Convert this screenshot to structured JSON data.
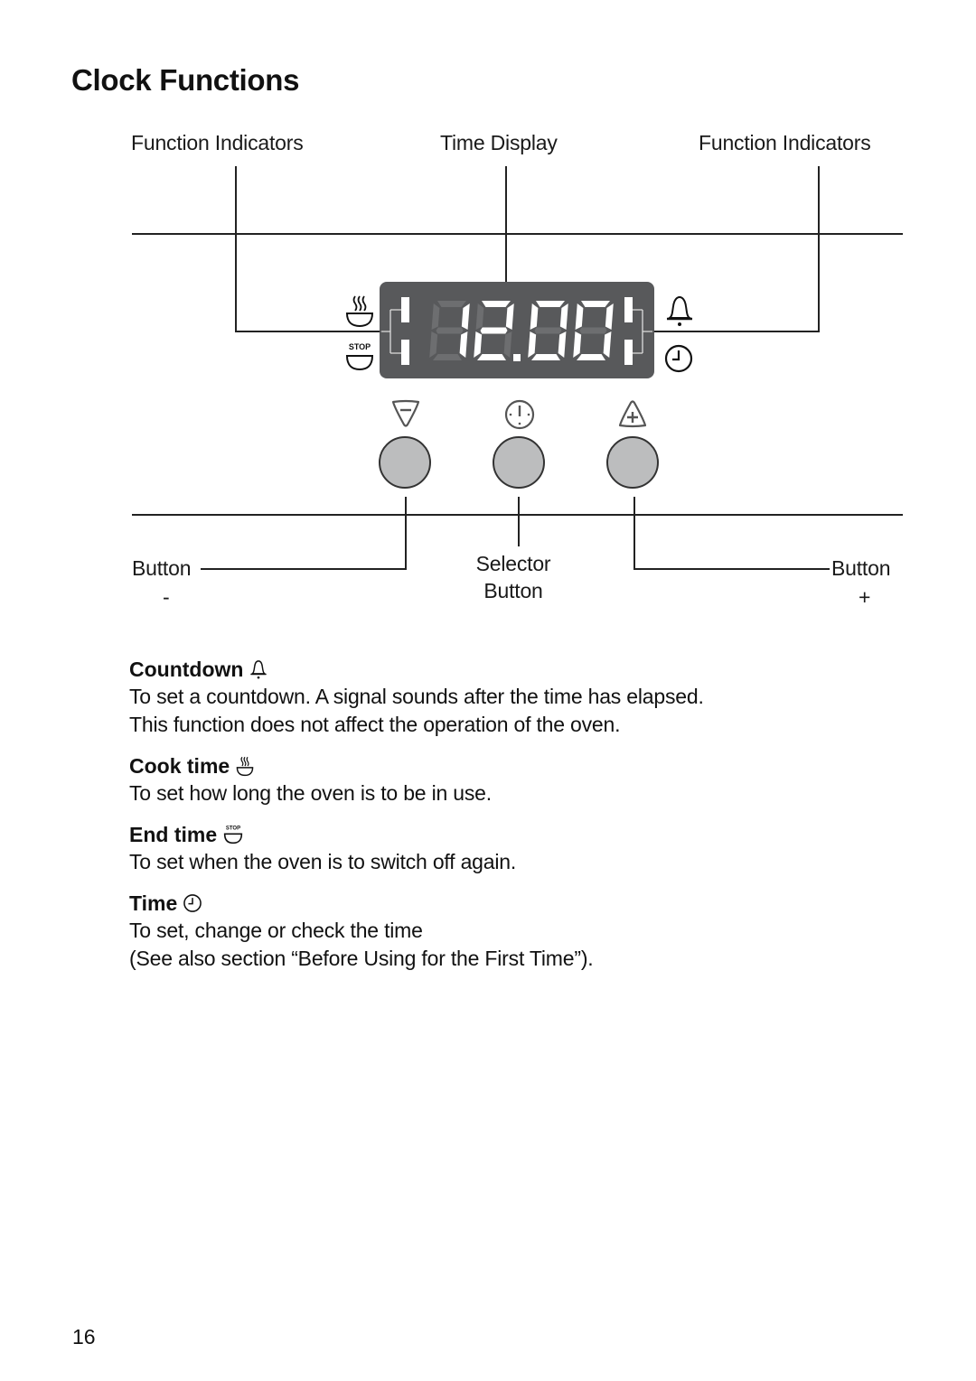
{
  "page": {
    "title": "Clock Functions",
    "page_number": "16"
  },
  "diagram": {
    "labels": {
      "function_indicators_left": "Function Indicators",
      "time_display": "Time Display",
      "function_indicators_right": "Function Indicators",
      "button_minus": "Button",
      "button_minus_sign": "-",
      "selector_button_line1": "Selector",
      "selector_button_line2": "Button",
      "button_plus": "Button",
      "button_plus_sign": "+"
    },
    "display": {
      "time_value": "12.00",
      "colors": {
        "panel": "#58595b",
        "segment_on": "#ffffff",
        "segment_off": "#6d6e70"
      }
    },
    "indicator_icons": {
      "left_top": "cook-time-icon",
      "left_bottom": "end-time-stop-icon",
      "right_top": "countdown-bell-icon",
      "right_bottom": "clock-time-icon"
    },
    "buttons": [
      {
        "name": "minus-button",
        "icon": "minus-triangle-icon"
      },
      {
        "name": "selector-button",
        "icon": "selector-clock-icon"
      },
      {
        "name": "plus-button",
        "icon": "plus-triangle-icon"
      }
    ],
    "button_color": "#bcbdbe"
  },
  "sections": [
    {
      "heading": "Countdown",
      "icon": "bell-icon",
      "lines": [
        "To set a countdown. A signal sounds after the time has elapsed.",
        "This function does not affect the operation of the oven."
      ]
    },
    {
      "heading": "Cook time",
      "icon": "cook-time-icon",
      "lines": [
        "To set how long the oven is to be in use."
      ]
    },
    {
      "heading": "End time",
      "icon": "end-time-stop-icon",
      "lines": [
        "To set when the oven is to switch off again."
      ]
    },
    {
      "heading": "Time",
      "icon": "clock-icon",
      "lines": [
        "To set, change or check the time",
        "(See also section “Before Using for the First Time”)."
      ]
    }
  ]
}
